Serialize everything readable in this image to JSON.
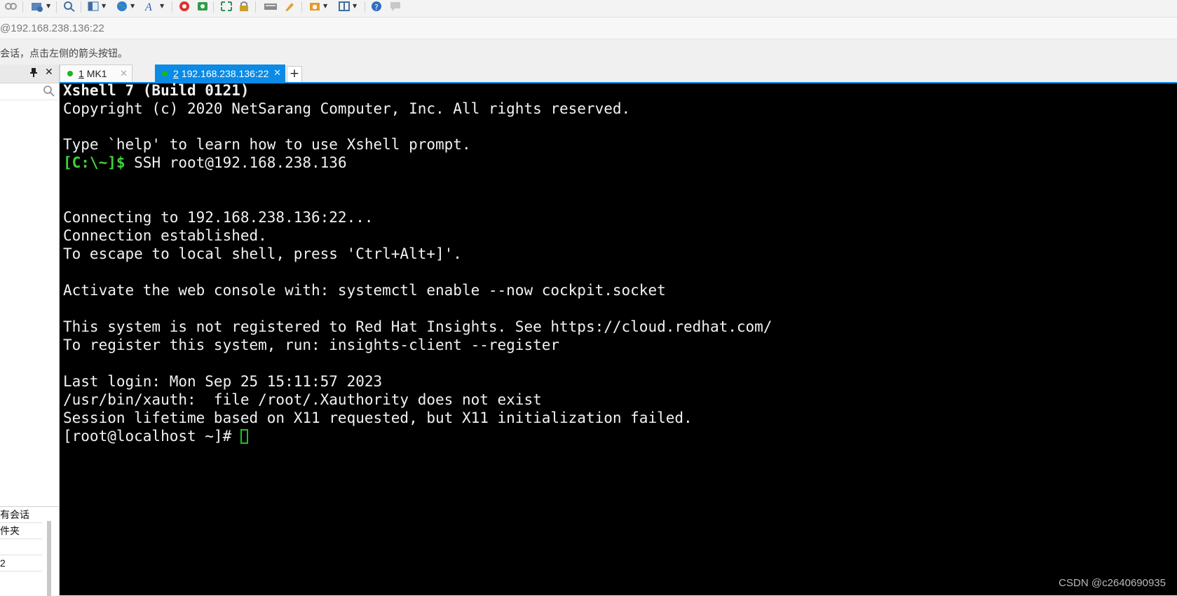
{
  "toolbar": {
    "icons": [
      "link-icon",
      "new-session-icon",
      "find-icon",
      "layout-icon",
      "globe-icon",
      "font-icon",
      "xftp-icon",
      "xagent-icon",
      "fullscreen-icon",
      "lock-icon",
      "keyboard-icon",
      "highlight-icon",
      "new-tab-icon",
      "tile-icon",
      "help-icon",
      "chat-icon"
    ]
  },
  "address_bar": {
    "text": "@192.168.238.136:22"
  },
  "hint_bar": {
    "text": "会话，点击左侧的箭头按钮。"
  },
  "session_panel": {
    "pin_glyph": "📌",
    "close_glyph": "✕",
    "items": [
      "有会话",
      "件夹",
      "",
      "2"
    ]
  },
  "tabs": [
    {
      "num": "1",
      "label": "MK1",
      "status_color": "#19b819"
    },
    {
      "num": "2",
      "label": "192.168.238.136:22",
      "status_color": "#19b819"
    }
  ],
  "terminal": {
    "line_1": "Xshell 7 (Build 0121)",
    "line_2": "Copyright (c) 2020 NetSarang Computer, Inc. All rights reserved.",
    "line_3": "Type `help' to learn how to use Xshell prompt.",
    "prompt_local": "[C:\\~]$",
    "cmd_local": " SSH root@192.168.238.136",
    "line_5": "Connecting to 192.168.238.136:22...",
    "line_6": "Connection established.",
    "line_7": "To escape to local shell, press 'Ctrl+Alt+]'.",
    "line_8": "Activate the web console with: systemctl enable --now cockpit.socket",
    "line_9": "This system is not registered to Red Hat Insights. See https://cloud.redhat.com/",
    "line_10": "To register this system, run: insights-client --register",
    "line_11": "Last login: Mon Sep 25 15:11:57 2023",
    "line_12": "/usr/bin/xauth:  file /root/.Xauthority does not exist",
    "line_13": "Session lifetime based on X11 requested, but X11 initialization failed.",
    "prompt_remote": "[root@localhost ~]# "
  },
  "watermark": "CSDN @c2640690935",
  "colors": {
    "accent": "#0b8ae6",
    "terminal_bg": "#000000",
    "prompt_green": "#3dd33d"
  }
}
